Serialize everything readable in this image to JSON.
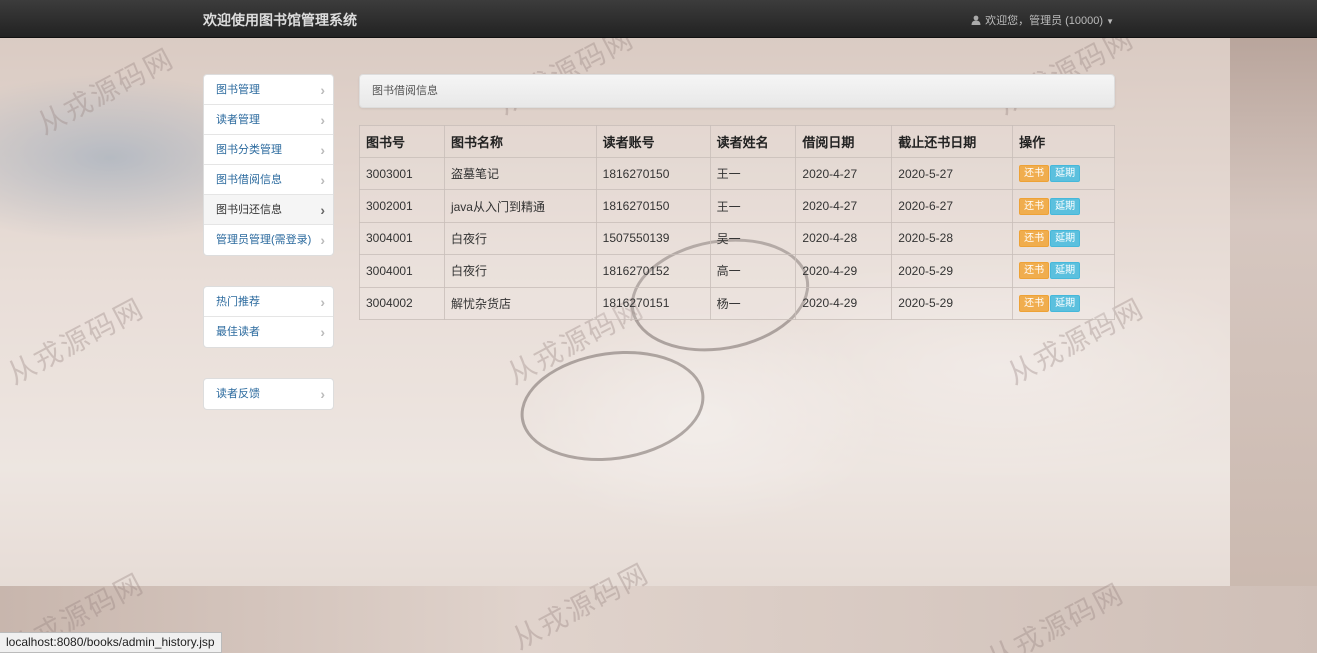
{
  "navbar": {
    "brand": "欢迎使用图书馆管理系统",
    "user_label": "欢迎您，管理员 (10000)"
  },
  "sidebar": {
    "group1": [
      {
        "label": "图书管理"
      },
      {
        "label": "读者管理"
      },
      {
        "label": "图书分类管理"
      },
      {
        "label": "图书借阅信息"
      },
      {
        "label": "图书归还信息",
        "active": true
      },
      {
        "label": "管理员管理(需登录)"
      }
    ],
    "group2": [
      {
        "label": "热门推荐"
      },
      {
        "label": "最佳读者"
      }
    ],
    "group3": [
      {
        "label": "读者反馈"
      }
    ]
  },
  "breadcrumb": {
    "title": "图书借阅信息"
  },
  "table": {
    "headers": [
      "图书号",
      "图书名称",
      "读者账号",
      "读者姓名",
      "借阅日期",
      "截止还书日期",
      "操作"
    ],
    "rows": [
      [
        "3003001",
        "盗墓笔记",
        "1816270150",
        "王一",
        "2020-4-27",
        "2020-5-27"
      ],
      [
        "3002001",
        "java从入门到精通",
        "1816270150",
        "王一",
        "2020-4-27",
        "2020-6-27"
      ],
      [
        "3004001",
        "白夜行",
        "1507550139",
        "吴一",
        "2020-4-28",
        "2020-5-28"
      ],
      [
        "3004001",
        "白夜行",
        "1816270152",
        "高一",
        "2020-4-29",
        "2020-5-29"
      ],
      [
        "3004002",
        "解忧杂货店",
        "1816270151",
        "杨一",
        "2020-4-29",
        "2020-5-29"
      ]
    ],
    "action_return": "还书",
    "action_extend": "延期"
  },
  "watermark": "从戎源码网",
  "statusbar": {
    "url": "localhost:8080/books/admin_history.jsp"
  },
  "icons": {
    "user": "user-icon",
    "caret": "caret-down-icon",
    "chevron": "chevron-right-icon"
  }
}
